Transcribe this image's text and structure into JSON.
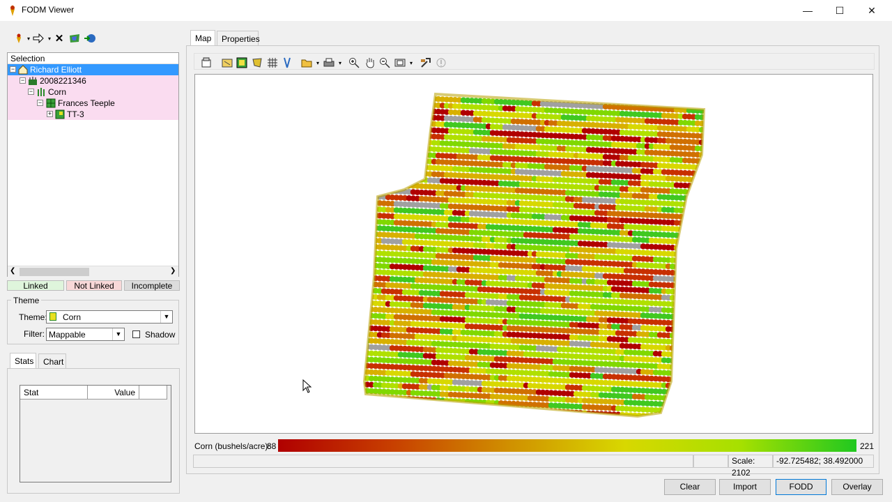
{
  "window": {
    "title": "FODM Viewer",
    "minimize": "—",
    "maximize": "☐",
    "close": "✕"
  },
  "left_toolbar": {
    "icons": [
      "wand-icon",
      "arrow-right-icon",
      "delete-icon",
      "map-icon",
      "globe-icon"
    ]
  },
  "tree": {
    "header": "Selection",
    "items": [
      {
        "label": "Richard Elliott",
        "expander": "−"
      },
      {
        "label": "2008221346",
        "expander": "−"
      },
      {
        "label": "Corn",
        "expander": "−"
      },
      {
        "label": "Frances Teeple",
        "expander": "−"
      },
      {
        "label": "TT-3",
        "expander": "+"
      }
    ]
  },
  "link_status": {
    "linked": "Linked",
    "not_linked": "Not Linked",
    "incomplete": "Incomplete"
  },
  "theme": {
    "group_label": "Theme",
    "theme_label": "Theme:",
    "theme_value": "Corn",
    "filter_label": "Filter:",
    "filter_value": "Mappable",
    "shadow_label": "Shadow"
  },
  "lower_tabs": {
    "stats": "Stats",
    "chart": "Chart"
  },
  "stats_table": {
    "columns": [
      "Stat",
      "Value"
    ]
  },
  "main_tabs": {
    "map": "Map",
    "properties": "Properties"
  },
  "legend": {
    "label": "Corn (bushels/acre):",
    "min": "88",
    "max": "221"
  },
  "status": {
    "scale": "Scale: 2102",
    "coords": "-92.725482; 38.492000"
  },
  "buttons": {
    "clear": "Clear",
    "import": "Import",
    "fodd": "FODD",
    "overlay": "Overlay"
  },
  "colors": {
    "selection": "#3399ff",
    "pink": "#fadcf0",
    "linked": "#dff5dc",
    "not_linked": "#f8d8d8",
    "incomplete": "#dcdcdc"
  }
}
